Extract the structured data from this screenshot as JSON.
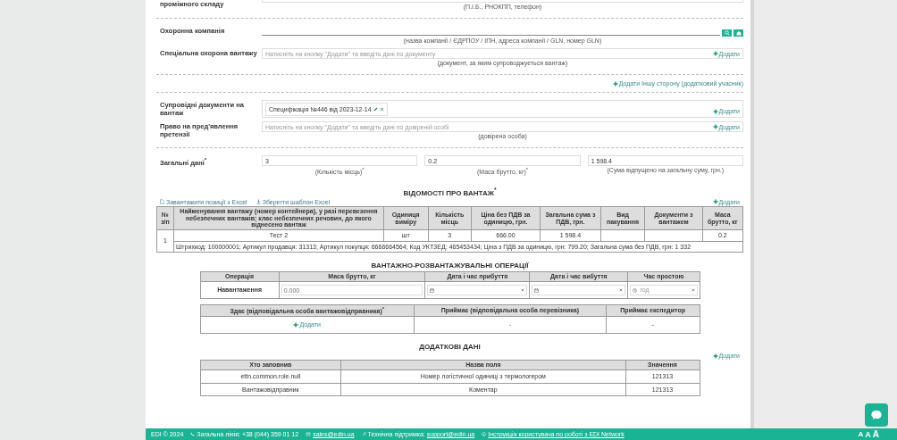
{
  "warehouse": {
    "label": "проміжного складу",
    "hint": "(П.І.Б., РНОКПП, телефон)"
  },
  "security": {
    "label": "Охоронна компанія",
    "hint": "(назва компанії / ЄДРПОУ / ІПН, адреса компанії / GLN, номер GLN)"
  },
  "special_guard": {
    "label": "Спеціальна охорона вантажу",
    "placeholder": "Натисніть на кнопку \"Додати\" та введіть дані по документу",
    "add": "Додати",
    "hint": "(документ, за яким супроводжується вантаж)"
  },
  "add_party": "Додати Іншу сторону (додатковий учасник)",
  "documents": {
    "label": "Супровідні документи на вантаж",
    "chip": "Специфікація №446 від 2023-12-14",
    "add": "Додати"
  },
  "claims": {
    "label": "Право на пред'явлення претензії",
    "placeholder": "Натисніть на кнопку \"Додати\" та введіть дані по довіреній особі",
    "add": "Додати",
    "hint": "(довірена особа)"
  },
  "general": {
    "label": "Загальні дані$^{*}$",
    "fields": [
      {
        "value": "3",
        "hint": "(Кількість місць)$^{*}$"
      },
      {
        "value": "0.2",
        "hint": "(Маса брутто, кг)$^{*}$"
      },
      {
        "value": "1 598.4",
        "hint": "(Сума відпущено на загальну суму, грн.)"
      }
    ]
  },
  "cargo": {
    "title": "ВІДОМОСТІ ПРО ВАНТАЖ$^{*}$",
    "tools": [
      "Завантажити позиції з Excel",
      "Зберегти шаблон Excel"
    ],
    "add": "Додати",
    "columns": [
      "№ з/п",
      "Найменування вантажу (номер контейнера), у разі перевезення небезпечних вантажів: клас небезпечних речовин, до якого віднесено вантаж",
      "Одиниця виміру",
      "Кількість місць",
      "Ціна без ПДВ за одиницю, грн.",
      "Загальна сума з ПДВ, грн.",
      "Вид пакування",
      "Документи з вантажем",
      "Маса брутто, кг"
    ],
    "rows": [
      {
        "cells": [
          "1",
          "Тест 2",
          "шт",
          "3",
          "666.00",
          "1 598.4",
          "",
          "",
          "0.2"
        ],
        "details": "Штрихкод: 100000001; Артикул продавця: 31313; Артикул покупця: 6666664564; Код УКТЗЕД: 465453434; Ціна з ПДВ за одиницю, грн: 799.20; Загальна сума без ПДВ, грн: 1 332"
      }
    ]
  },
  "operations": {
    "title": "ВАНТАЖНО-РОЗВАНТАЖУВАЛЬНІ ОПЕРАЦІЇ",
    "columns": [
      "Операція",
      "Маса брутто, кг",
      "Дата і час прибуття",
      "Дата і час вибуття",
      "Час простою"
    ],
    "row": {
      "operation": "Навантаження",
      "mass_placeholder": "0.000",
      "idle_placeholder": "год"
    },
    "party_columns": [
      "Здає (відповідальна особа вантажовідправника)$^{*}$",
      "Приймає (відповідальна особа перевізника)",
      "Приймає експедитор"
    ],
    "party_cells": [
      {
        "kind": "add",
        "text": "Додати"
      },
      {
        "kind": "text",
        "text": "-"
      },
      {
        "kind": "text",
        "text": "-"
      }
    ]
  },
  "extra": {
    "title": "ДОДАТКОВІ ДАНІ",
    "add": "Додати",
    "columns": [
      "Хто заповнив",
      "Назва поля",
      "Значення"
    ],
    "rows": [
      [
        "ettn.common.role.null",
        "Номер логістичної одиниці з термологером",
        "121313"
      ],
      [
        "Вантажовідправник",
        "Коментар",
        "121313"
      ]
    ]
  },
  "footer": {
    "copyright": "EDI © 2024",
    "phone": "Загальна лінія: +38 (044) 359 01 12",
    "sales": "sales@edin.ua",
    "support_label": "Технічна підтримка:",
    "support": "support@edin.ua",
    "manual": "Інструкція користувача по роботі з EDI Network",
    "font_sizes": [
      "A",
      "A",
      "A"
    ]
  }
}
